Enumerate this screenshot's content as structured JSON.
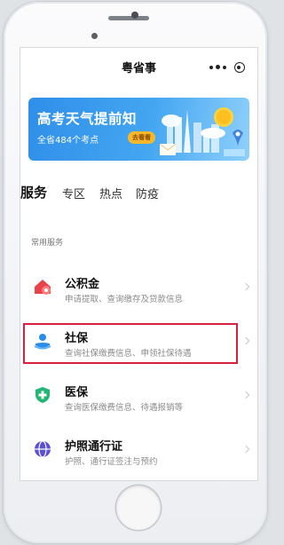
{
  "app": {
    "title": "粤省事"
  },
  "colors": {
    "accent": "#2f8fe9",
    "highlight": "#d8213e",
    "badge": "#f6b72a"
  },
  "banner": {
    "title": "高考天气提前知",
    "subtitle": "全省484个考点",
    "button_label": "去看看",
    "icon": "city-weather-illustration"
  },
  "tabs": [
    {
      "label": "服务",
      "active": true
    },
    {
      "label": "专区",
      "active": false
    },
    {
      "label": "热点",
      "active": false
    },
    {
      "label": "防疫",
      "active": false
    }
  ],
  "section": {
    "label": "常用服务"
  },
  "services": [
    {
      "title": "公积金",
      "desc": "申请提取、查询缴存及贷款信息",
      "icon": "housing-fund-icon"
    },
    {
      "title": "社保",
      "desc": "查询社保缴费信息、申领社保待遇",
      "icon": "social-security-icon"
    },
    {
      "title": "医保",
      "desc": "查询医保缴费信息、待遇报销等",
      "icon": "medical-insurance-icon"
    },
    {
      "title": "护照通行证",
      "desc": "护照、通行证签注与预约",
      "icon": "passport-icon"
    }
  ]
}
